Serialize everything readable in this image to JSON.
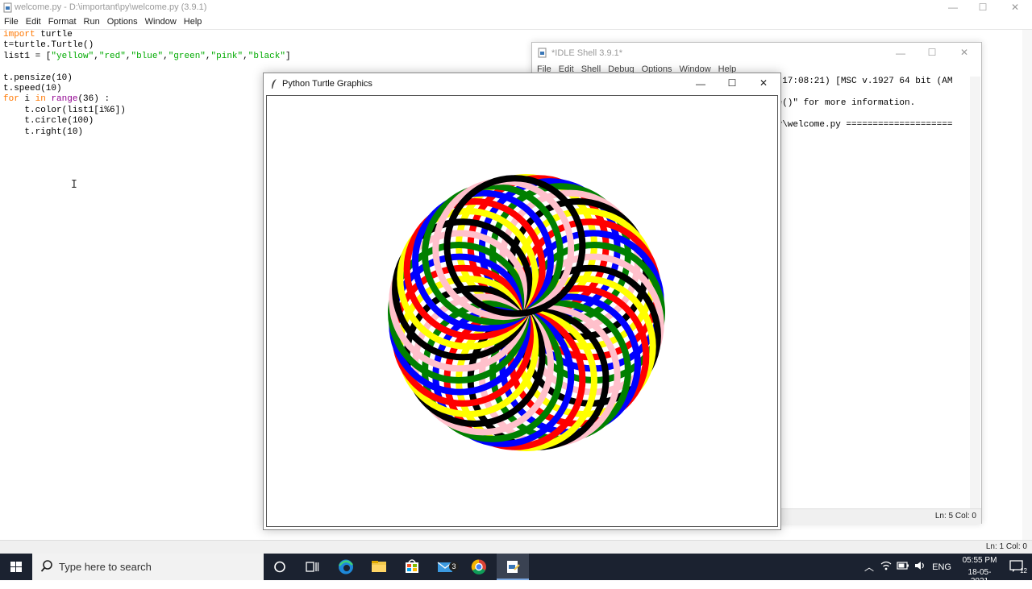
{
  "editor": {
    "title": "welcome.py - D:\\important\\py\\welcome.py (3.9.1)",
    "menu": [
      "File",
      "Edit",
      "Format",
      "Run",
      "Options",
      "Window",
      "Help"
    ],
    "status": "Ln: 1   Col: 0",
    "code": [
      [
        {
          "t": "import",
          "c": "kw"
        },
        {
          "t": " turtle"
        }
      ],
      [
        {
          "t": "t=turtle.Turtle()"
        }
      ],
      [
        {
          "t": "list1 = ["
        },
        {
          "t": "\"yellow\"",
          "c": "st"
        },
        {
          "t": ","
        },
        {
          "t": "\"red\"",
          "c": "st"
        },
        {
          "t": ","
        },
        {
          "t": "\"blue\"",
          "c": "st"
        },
        {
          "t": ","
        },
        {
          "t": "\"green\"",
          "c": "st"
        },
        {
          "t": ","
        },
        {
          "t": "\"pink\"",
          "c": "st"
        },
        {
          "t": ","
        },
        {
          "t": "\"black\"",
          "c": "st"
        },
        {
          "t": "]"
        }
      ],
      [
        {
          "t": ""
        }
      ],
      [
        {
          "t": "t.pensize(10)"
        }
      ],
      [
        {
          "t": "t.speed(10)"
        }
      ],
      [
        {
          "t": "for",
          "c": "kw"
        },
        {
          "t": " i "
        },
        {
          "t": "in",
          "c": "kw"
        },
        {
          "t": " "
        },
        {
          "t": "range",
          "c": "bi"
        },
        {
          "t": "(36) :"
        }
      ],
      [
        {
          "t": "    t.color(list1[i%6])"
        }
      ],
      [
        {
          "t": "    t.circle(100)"
        }
      ],
      [
        {
          "t": "    t.right(10)"
        }
      ]
    ]
  },
  "shell": {
    "title": "*IDLE Shell 3.9.1*",
    "menu": [
      "File",
      "Edit",
      "Shell",
      "Debug",
      "Options",
      "Window",
      "Help"
    ],
    "lines": [
      ", 17:08:21) [MSC v.1927 64 bit (AM",
      "",
      "se()\" for more information.",
      "",
      "py\\welcome.py ===================="
    ],
    "status": "Ln: 5   Col: 0"
  },
  "turtle": {
    "title": "Python Turtle Graphics",
    "colors": [
      "yellow",
      "red",
      "blue",
      "green",
      "pink",
      "black"
    ],
    "steps": 36,
    "turn_deg": 10,
    "radius": 100,
    "pensize": 10
  },
  "taskbar": {
    "search_placeholder": "Type here to search",
    "mail_badge": "3",
    "lang": "ENG",
    "time": "05:55 PM",
    "date": "18-05-2021",
    "notif_count": "12"
  }
}
